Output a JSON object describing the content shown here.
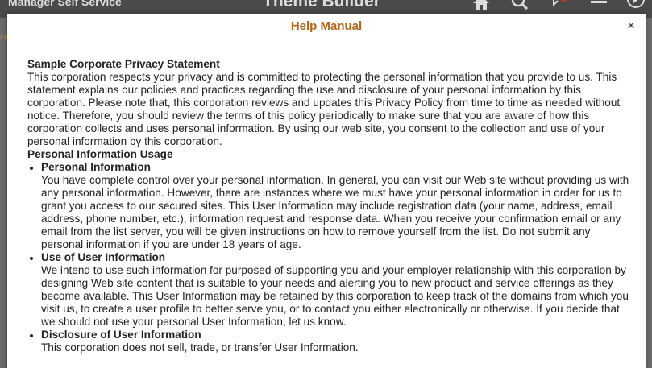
{
  "background": {
    "left_title": "Manager Self Service",
    "center_title": "Theme Builder",
    "left_fragment": "ra"
  },
  "modal": {
    "title": "Help Manual",
    "close_label": "×",
    "heading": "Sample Corporate Privacy Statement",
    "intro": "This corporation respects your privacy and is committed to protecting the personal information that you provide to us. This statement explains our policies and practices regarding the use and disclosure of your personal information by this corporation. Please note that, this corporation reviews and updates this Privacy Policy from time to time as needed without notice. Therefore, you should review the terms of this policy periodically to make sure that you are aware of how this corporation collects and uses personal information. By using our web site, you consent to the collection and use of your personal information by this corporation.",
    "section_heading": "Personal Information Usage",
    "items": [
      {
        "title": "Personal Information",
        "text": "You have complete control over your personal information. In general, you can visit our Web site without providing us with any personal information. However, there are instances where we must have your personal information in order for us to grant you access to our secured sites. This User Information may include registration data (your name, address, email address, phone number, etc.), information request and response data. When you receive your confirmation email or any email from the list server, you will be given instructions on how to remove yourself from the list. Do not submit any personal information if you are under 18 years of age."
      },
      {
        "title": "Use of User Information",
        "text": "We intend to use such information for purposed of supporting you and your employer relationship with this corporation by designing Web site content that is suitable to your needs and alerting you to new product and service offerings as they become available. This User Information may be retained by this corporation to keep track of the domains from which you visit us, to create a user profile to better serve you, or to contact you either electronically or otherwise. If you decide that we should not use your personal User Information, let us know."
      },
      {
        "title": "Disclosure of User Information",
        "text": "This corporation does not sell, trade, or transfer User Information."
      }
    ]
  }
}
